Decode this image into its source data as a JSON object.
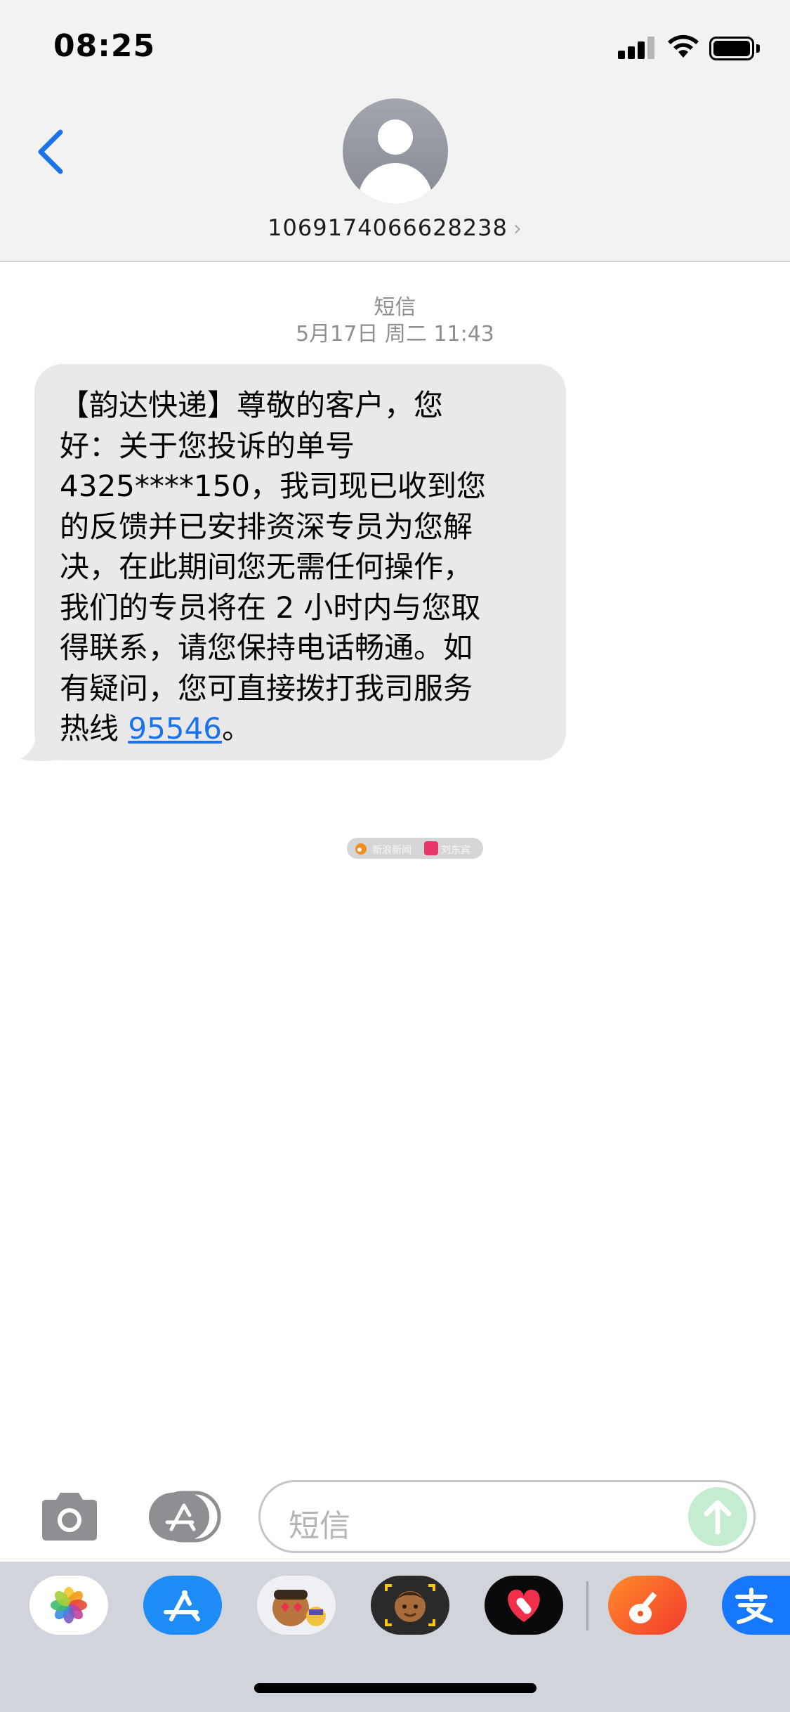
{
  "status_bar": {
    "time": "08:25"
  },
  "header": {
    "contact_number": "1069174066628238",
    "contact_chevron": "›"
  },
  "thread": {
    "service_label": "短信",
    "timestamp": "5月17日 周二 11:43",
    "message": {
      "body": "【韵达快递】尊敬的客户，您\n好：关于您投诉的单号\n4325****150，我司现已收到您\n的反馈并已安排资深专员为您解\n决，在此期间您无需任何操作，\n我们的专员将在 2 小时内与您取\n得联系，请您保持电话畅通。如\n有疑问，您可直接拨打我司服务\n热线 ",
      "phone_link": "95546",
      "trailing": "。"
    }
  },
  "watermark": {
    "left_text": "新浪新闻",
    "right_text": "刘东宾"
  },
  "input": {
    "placeholder": "短信"
  },
  "icons": {
    "back": "chevron-left-icon",
    "camera": "camera-icon",
    "apps": "app-store-icon",
    "send": "arrow-up-icon"
  },
  "colors": {
    "accent": "#1a73e8",
    "bubble": "#e9e9eb",
    "header_bg": "#f2f2f2",
    "send_disabled": "#c5ecd1"
  }
}
